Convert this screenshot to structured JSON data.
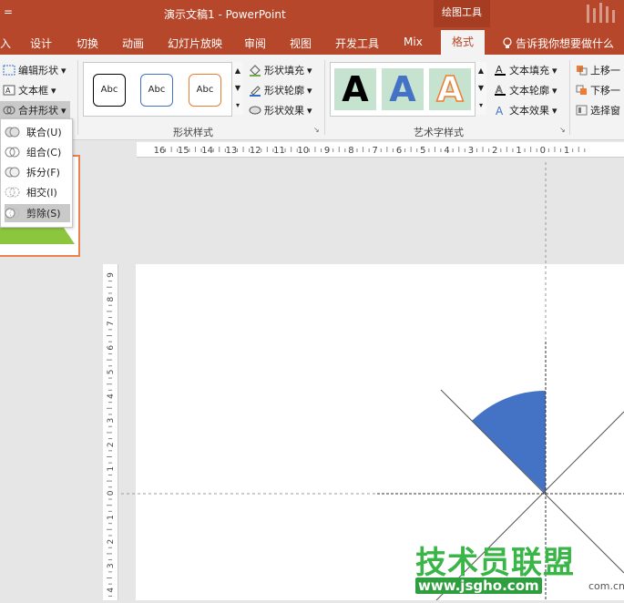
{
  "titlebar": {
    "qa_symbol": "=",
    "title": "演示文稿1  -  PowerPoint",
    "context_tab": "绘图工具"
  },
  "tabs": [
    {
      "label": "入"
    },
    {
      "label": "设计"
    },
    {
      "label": "切换"
    },
    {
      "label": "动画"
    },
    {
      "label": "幻灯片放映"
    },
    {
      "label": "审阅"
    },
    {
      "label": "视图"
    },
    {
      "label": "开发工具"
    },
    {
      "label": "Mix"
    },
    {
      "label": "格式"
    }
  ],
  "tell_me": "告诉我你想要做什么",
  "ribbon": {
    "insert_shapes": {
      "edit_shape": "编辑形状",
      "text_box": "文本框",
      "merge_shapes": "合并形状"
    },
    "shape_styles": {
      "group_label": "形状样式",
      "swatch_text": [
        "Abc",
        "Abc",
        "Abc"
      ],
      "swatch_colors": [
        "#000000",
        "#4472c4",
        "#ed7d31"
      ],
      "fill": "形状填充",
      "outline": "形状轮廓",
      "effects": "形状效果"
    },
    "wordart_styles": {
      "group_label": "艺术字样式",
      "letters": [
        "A",
        "A",
        "A"
      ],
      "text_fill": "文本填充",
      "text_outline": "文本轮廓",
      "text_effects": "文本效果"
    },
    "arrange": {
      "bring_forward": "上移一",
      "send_backward": "下移一",
      "selection_pane": "选择窗"
    }
  },
  "merge_menu": {
    "items": [
      {
        "label": "联合(U)"
      },
      {
        "label": "组合(C)"
      },
      {
        "label": "拆分(F)"
      },
      {
        "label": "相交(I)"
      },
      {
        "label": "剪除(S)"
      }
    ],
    "selected_index": 4
  },
  "ruler": {
    "horizontal": [
      "16",
      "15",
      "14",
      "13",
      "12",
      "11",
      "10",
      "9",
      "8",
      "7",
      "6",
      "5",
      "4",
      "3",
      "2",
      "1",
      "0",
      "1"
    ],
    "vertical": [
      "9",
      "8",
      "7",
      "6",
      "5",
      "4",
      "3",
      "2",
      "1",
      "0",
      "1",
      "2",
      "3",
      "4"
    ]
  },
  "colors": {
    "accent": "#b7472a",
    "shape_fill": "#4472c4",
    "watermark_green": "#3ab648"
  },
  "watermark": {
    "text": "技术员联盟",
    "url": "www.jsgho.com",
    "suffix": "com.cn"
  }
}
